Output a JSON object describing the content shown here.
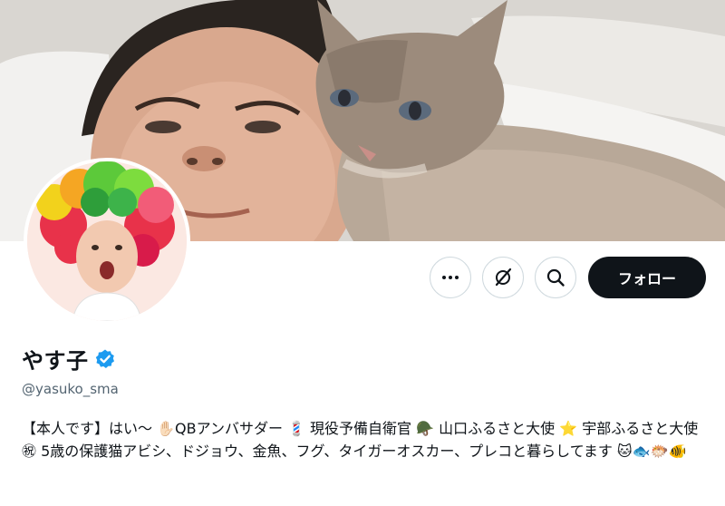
{
  "profile": {
    "display_name": "やす子",
    "handle": "@yasuko_sma",
    "bio": "【本人です】はい〜 ✋🏻QBアンバサダー 💈 現役予備自衛官 🪖 山口ふるさと大使 ⭐ 宇部ふるさと大使 ㊗ 5歳の保護猫アビシ、ドジョウ、金魚、フグ、タイガーオスカー、プレコと暮らしてます 🐱🐟🐡🐠"
  },
  "actions": {
    "follow_label": "フォロー",
    "more_icon": "more-dots-icon",
    "grok_icon": "grok-icon",
    "search_icon": "search-icon"
  },
  "colors": {
    "follow_bg": "#0f1419",
    "verified": "#1d9bf0",
    "handle": "#536471"
  }
}
